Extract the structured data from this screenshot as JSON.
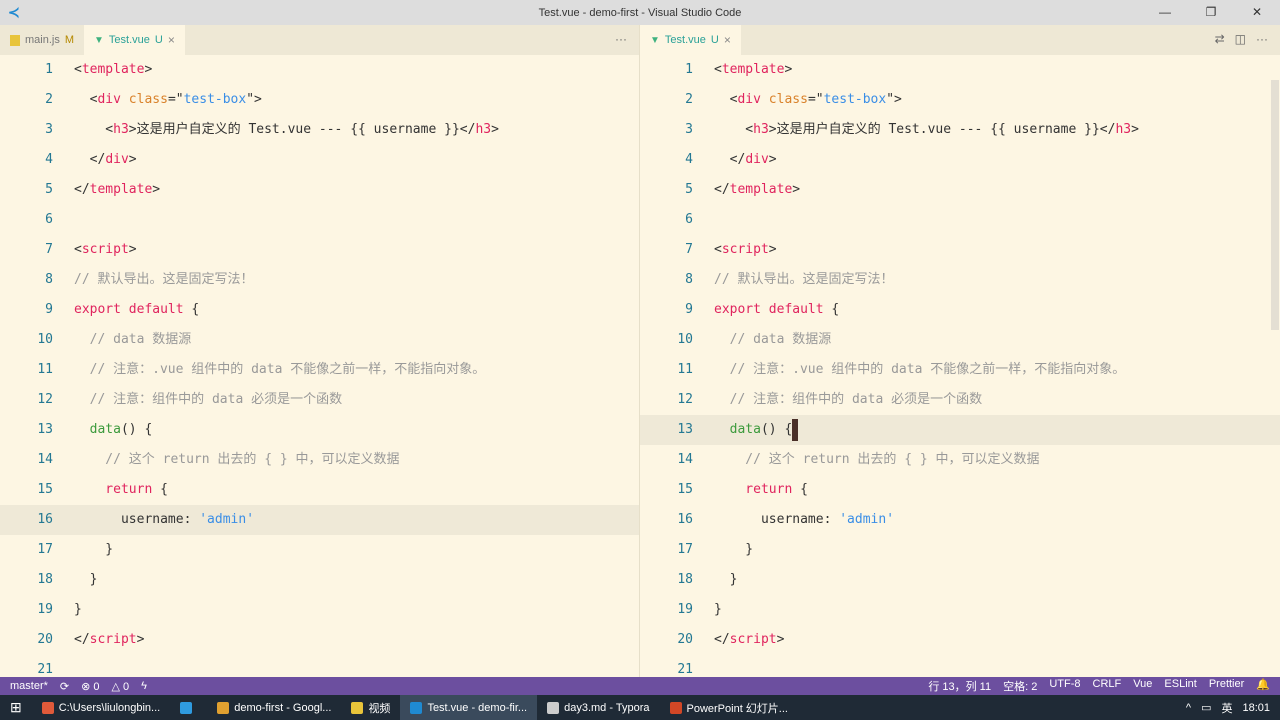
{
  "window": {
    "title": "Test.vue - demo-first - Visual Studio Code",
    "min": "—",
    "max": "❐",
    "close": "✕"
  },
  "left_pane": {
    "tabs": [
      {
        "label": "main.js",
        "badge": "M"
      },
      {
        "label": "Test.vue",
        "badge": "U",
        "close": "×"
      }
    ],
    "more": "···",
    "highlight_line": 16
  },
  "right_pane": {
    "tabs": [
      {
        "label": "Test.vue",
        "badge": "U",
        "close": "×"
      }
    ],
    "actions": [
      "⇄",
      "◫",
      "···"
    ],
    "highlight_line": 13
  },
  "code": [
    [
      [
        "pl",
        "<"
      ],
      [
        "tag",
        "template"
      ],
      [
        "pl",
        ">"
      ]
    ],
    [
      [
        "pl",
        "  <"
      ],
      [
        "tag",
        "div"
      ],
      [
        "pl",
        " "
      ],
      [
        "attr",
        "class"
      ],
      [
        "pl",
        "=\""
      ],
      [
        "str",
        "test-box"
      ],
      [
        "pl",
        "\">"
      ]
    ],
    [
      [
        "pl",
        "    <"
      ],
      [
        "tag",
        "h3"
      ],
      [
        "pl",
        ">这是用户自定义的 Test.vue --- {{ username }}</"
      ],
      [
        "tag",
        "h3"
      ],
      [
        "pl",
        ">"
      ]
    ],
    [
      [
        "pl",
        "  </"
      ],
      [
        "tag",
        "div"
      ],
      [
        "pl",
        ">"
      ]
    ],
    [
      [
        "pl",
        "</"
      ],
      [
        "tag",
        "template"
      ],
      [
        "pl",
        ">"
      ]
    ],
    [],
    [
      [
        "pl",
        "<"
      ],
      [
        "tag",
        "script"
      ],
      [
        "pl",
        ">"
      ]
    ],
    [
      [
        "cm",
        "// 默认导出。这是固定写法！"
      ]
    ],
    [
      [
        "kw",
        "export default"
      ],
      [
        "pl",
        " {"
      ]
    ],
    [
      [
        "cm",
        "  // data 数据源"
      ]
    ],
    [
      [
        "cm",
        "  // 注意：.vue 组件中的 data 不能像之前一样，不能指向对象。"
      ]
    ],
    [
      [
        "cm",
        "  // 注意：组件中的 data 必须是一个函数"
      ]
    ],
    [
      [
        "fn",
        "  data"
      ],
      [
        "pl",
        "() {"
      ]
    ],
    [
      [
        "cm",
        "    // 这个 return 出去的 { } 中，可以定义数据"
      ]
    ],
    [
      [
        "kw",
        "    return"
      ],
      [
        "pl",
        " {"
      ]
    ],
    [
      [
        "pl",
        "      username: "
      ],
      [
        "str",
        "'admin'"
      ]
    ],
    [
      [
        "pl",
        "    }"
      ]
    ],
    [
      [
        "pl",
        "  }"
      ]
    ],
    [
      [
        "pl",
        "}"
      ]
    ],
    [
      [
        "pl",
        "</"
      ],
      [
        "tag",
        "script"
      ],
      [
        "pl",
        ">"
      ]
    ],
    []
  ],
  "statusbar": {
    "branch": "master*",
    "sync": "⟳",
    "errors": "⊗ 0",
    "warnings": "△ 0",
    "bolt": "ϟ",
    "position": "行 13，列 11",
    "spaces": "空格: 2",
    "encoding": "UTF-8",
    "eol": "CRLF",
    "language": "Vue",
    "eslint": "ESLint",
    "prettier": "Prettier",
    "bell": "🔔"
  },
  "taskbar": {
    "items": [
      {
        "label": "C:\\Users\\liulongbin...",
        "color": "#e05a3a"
      },
      {
        "label": "",
        "color": "#2f9be0"
      },
      {
        "label": "demo-first - Googl...",
        "color": "#e0a030"
      },
      {
        "label": "视频",
        "color": "#e8c43a"
      },
      {
        "label": "Test.vue - demo-fir...",
        "color": "#1f8ad2"
      },
      {
        "label": "day3.md - Typora",
        "color": "#ccc"
      },
      {
        "label": "PowerPoint 幻灯片...",
        "color": "#d24726"
      }
    ],
    "ime": "英",
    "time": "18:01"
  }
}
